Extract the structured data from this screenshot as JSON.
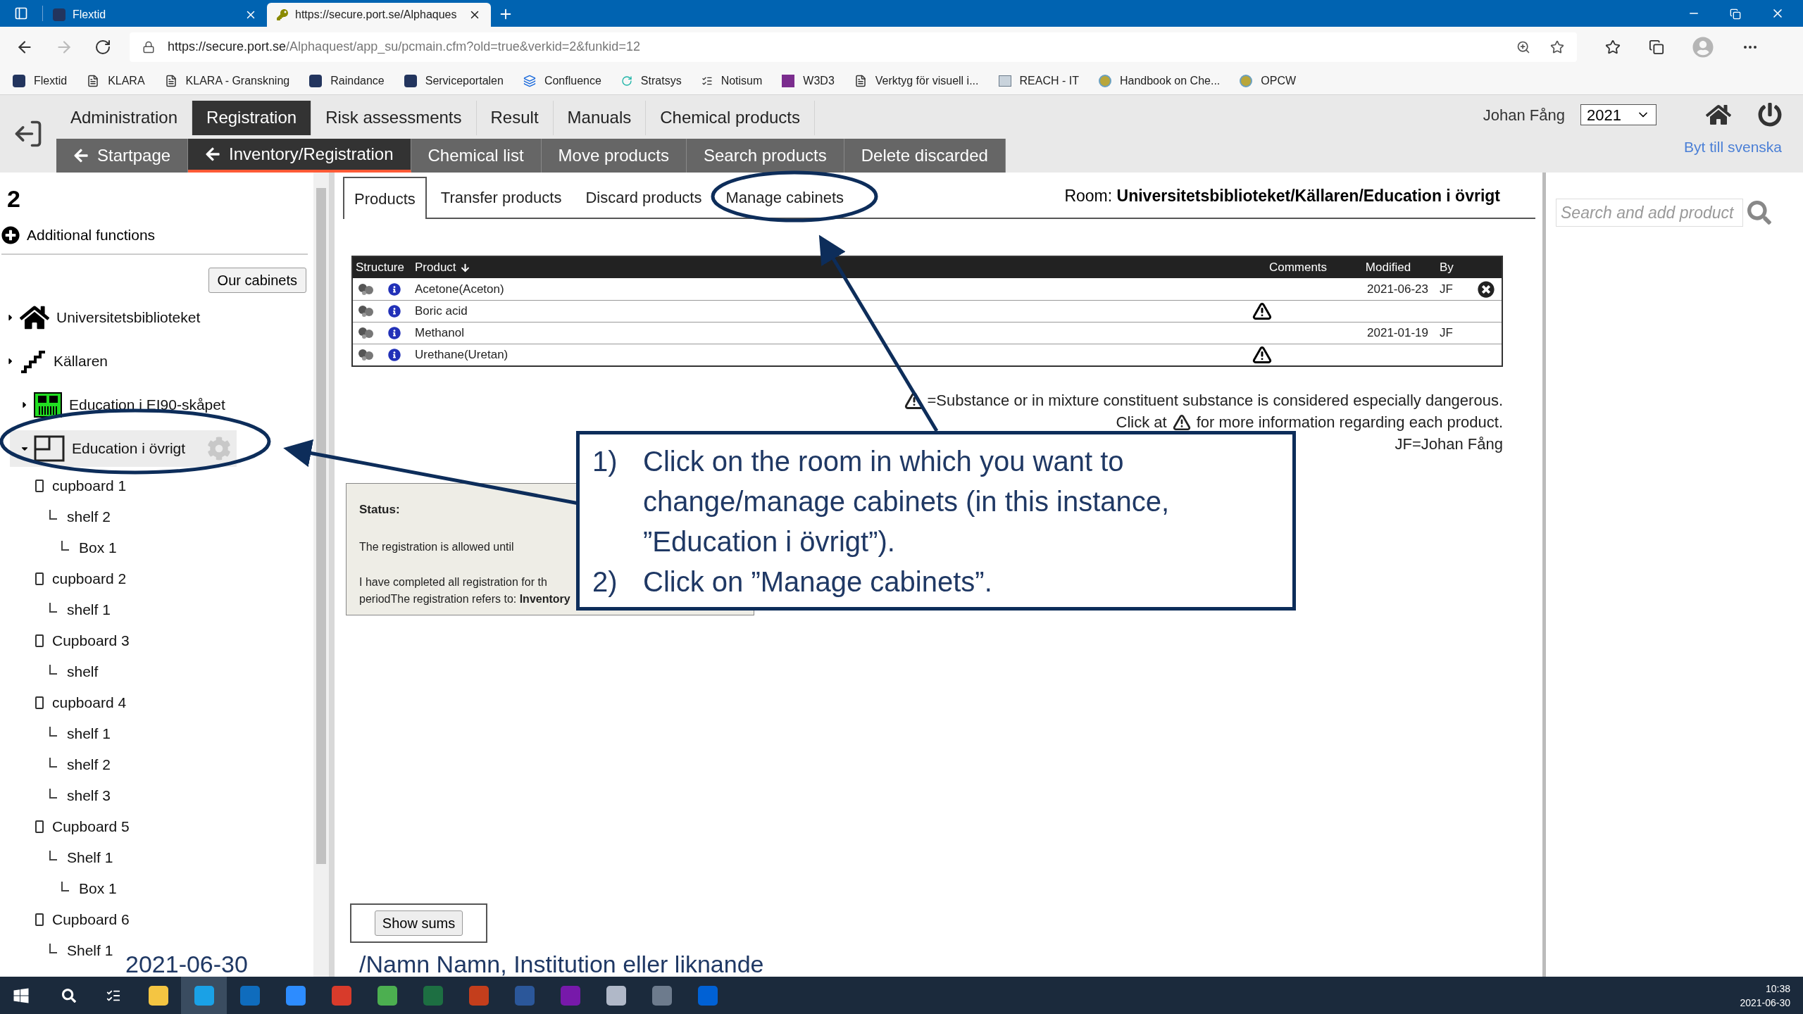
{
  "browser": {
    "tabs": [
      {
        "title": "Flextid",
        "kind": "crest",
        "selected": false
      },
      {
        "title": "https://secure.port.se/Alphaques",
        "kind": "key",
        "selected": true
      }
    ],
    "url": {
      "host": "https://secure.port.se",
      "path": "/Alphaquest/app_su/pcmain.cfm?old=true&verkid=2&funkid=12"
    },
    "bookmarks": [
      {
        "label": "Flextid",
        "kind": "crest"
      },
      {
        "label": "KLARA",
        "kind": "page"
      },
      {
        "label": "KLARA - Granskning",
        "kind": "page"
      },
      {
        "label": "Raindance",
        "kind": "crest"
      },
      {
        "label": "Serviceportalen",
        "kind": "crest"
      },
      {
        "label": "Confluence",
        "kind": "confluence"
      },
      {
        "label": "Stratsys",
        "kind": "stratsys"
      },
      {
        "label": "Notisum",
        "kind": "notisum"
      },
      {
        "label": "W3D3",
        "kind": "w3"
      },
      {
        "label": "Verktyg för visuell i...",
        "kind": "page"
      },
      {
        "label": "REACH - IT",
        "kind": "reach"
      },
      {
        "label": "Handbook on Che...",
        "kind": "globe"
      },
      {
        "label": "OPCW",
        "kind": "globe"
      }
    ]
  },
  "app": {
    "menu": [
      {
        "label": "Administration",
        "selected": false
      },
      {
        "label": "Registration",
        "selected": true
      },
      {
        "label": "Risk assessments",
        "selected": false
      },
      {
        "label": "Result",
        "selected": false
      },
      {
        "label": "Manuals",
        "selected": false
      },
      {
        "label": "Chemical products",
        "selected": false
      }
    ],
    "submenu": [
      {
        "label": "Startpage",
        "arrow": true,
        "selected": false
      },
      {
        "label": "Inventory/Registration",
        "arrow": true,
        "selected": true
      },
      {
        "label": "Chemical list",
        "arrow": false,
        "selected": false
      },
      {
        "label": "Move products",
        "arrow": false,
        "selected": false
      },
      {
        "label": "Search products",
        "arrow": false,
        "selected": false
      },
      {
        "label": "Delete discarded",
        "arrow": false,
        "selected": false
      }
    ],
    "user": "Johan Fång",
    "year": "2021",
    "language_link": "Byt till svenska"
  },
  "sidebar": {
    "heading": "2",
    "additional_functions": "Additional functions",
    "cabinets_button": "Our cabinets",
    "tree": [
      {
        "label": "Universitetsbiblioteket",
        "kind": "building",
        "expanded": false,
        "selected": false
      },
      {
        "label": "Källaren",
        "kind": "floor",
        "expanded": false,
        "selected": false,
        "children": [
          {
            "label": "Education i EI90-skåpet",
            "kind": "storage",
            "expanded": false,
            "selected": false
          },
          {
            "label": "Education i övrigt",
            "kind": "room",
            "expanded": true,
            "selected": true,
            "children": [
              {
                "label": "cupboard 1",
                "kind": "cupboard",
                "selected": false,
                "children": [
                  {
                    "label": "shelf 2",
                    "kind": "shelf",
                    "selected": false,
                    "children": [
                      {
                        "label": "Box 1",
                        "kind": "shelf",
                        "selected": false
                      }
                    ]
                  }
                ]
              },
              {
                "label": "cupboard 2",
                "kind": "cupboard",
                "selected": false,
                "children": [
                  {
                    "label": "shelf 1",
                    "kind": "shelf",
                    "selected": false
                  }
                ]
              },
              {
                "label": "Cupboard 3",
                "kind": "cupboard",
                "selected": false,
                "children": [
                  {
                    "label": "shelf",
                    "kind": "shelf",
                    "selected": false
                  }
                ]
              },
              {
                "label": "cupboard 4",
                "kind": "cupboard",
                "selected": false,
                "children": [
                  {
                    "label": "shelf 1",
                    "kind": "shelf",
                    "selected": false
                  },
                  {
                    "label": "shelf 2",
                    "kind": "shelf",
                    "selected": false
                  },
                  {
                    "label": "shelf 3",
                    "kind": "shelf",
                    "selected": false
                  }
                ]
              },
              {
                "label": "Cupboard 5",
                "kind": "cupboard",
                "selected": false,
                "children": [
                  {
                    "label": "Shelf 1",
                    "kind": "shelf",
                    "selected": false,
                    "children": [
                      {
                        "label": "Box 1",
                        "kind": "shelf",
                        "selected": false
                      }
                    ]
                  }
                ]
              },
              {
                "label": "Cupboard 6",
                "kind": "cupboard",
                "selected": false,
                "children": [
                  {
                    "label": "Shelf 1",
                    "kind": "shelf",
                    "selected": false
                  }
                ]
              }
            ]
          }
        ]
      }
    ]
  },
  "main": {
    "tabs": [
      {
        "label": "Products",
        "selected": true
      },
      {
        "label": "Transfer products",
        "selected": false
      },
      {
        "label": "Discard products",
        "selected": false
      },
      {
        "label": "Manage cabinets",
        "selected": false
      }
    ],
    "room_label": "Room:",
    "room_path": "Universitetsbiblioteket/Källaren/Education i övrigt",
    "table": {
      "columns": [
        "Structure",
        "Product",
        "Comments",
        "Modified",
        "By"
      ],
      "rows": [
        {
          "product": "Acetone(Aceton)",
          "warning": false,
          "modified": "2021-06-23",
          "by": "JF",
          "removable": true
        },
        {
          "product": "Boric acid",
          "warning": true,
          "removable": false
        },
        {
          "product": "Methanol",
          "warning": false,
          "modified": "2021-01-19",
          "by": "JF",
          "removable": false
        },
        {
          "product": "Urethane(Uretan)",
          "warning": true,
          "removable": false
        }
      ]
    },
    "legend": {
      "danger_note": "=Substance or in mixture constituent substance is considered especially dangerous.",
      "info_prefix": "Click at",
      "info_suffix": "for more information regarding each product.",
      "initials": "JF=Johan Fång"
    },
    "status": {
      "title": "Status:",
      "allowed_until": "The registration is allowed until",
      "completed": "I have completed all registration for th",
      "refers_to": "periodThe registration refers to: **Inventory**"
    },
    "show_sums": "Show sums"
  },
  "search": {
    "placeholder": "Search and add product"
  },
  "taskbar": {
    "apps": [
      {
        "kind": "files",
        "selected": false
      },
      {
        "kind": "edge",
        "selected": true
      },
      {
        "kind": "outlook",
        "selected": false
      },
      {
        "kind": "zoom",
        "selected": false
      },
      {
        "kind": "shield",
        "selected": false
      },
      {
        "kind": "chrome",
        "selected": false
      },
      {
        "kind": "excel",
        "selected": false
      },
      {
        "kind": "powerpoint",
        "selected": false
      },
      {
        "kind": "word",
        "selected": false
      },
      {
        "kind": "onenote",
        "selected": false
      },
      {
        "kind": "paint",
        "selected": false
      },
      {
        "kind": "calculator",
        "selected": false
      },
      {
        "kind": "box",
        "selected": false
      }
    ],
    "time": "10:38",
    "date": "2021-06-30"
  },
  "annotations": {
    "steps": [
      {
        "number": "1)",
        "text": "Click on the room in which you want to change/manage cabinets (in this instance, ”Education i övrigt”)."
      },
      {
        "number": "2)",
        "text": "Click on ”Manage cabinets”."
      }
    ],
    "footer_date": "2021-06-30",
    "footer_author": "/Namn Namn, Institution eller liknande"
  }
}
